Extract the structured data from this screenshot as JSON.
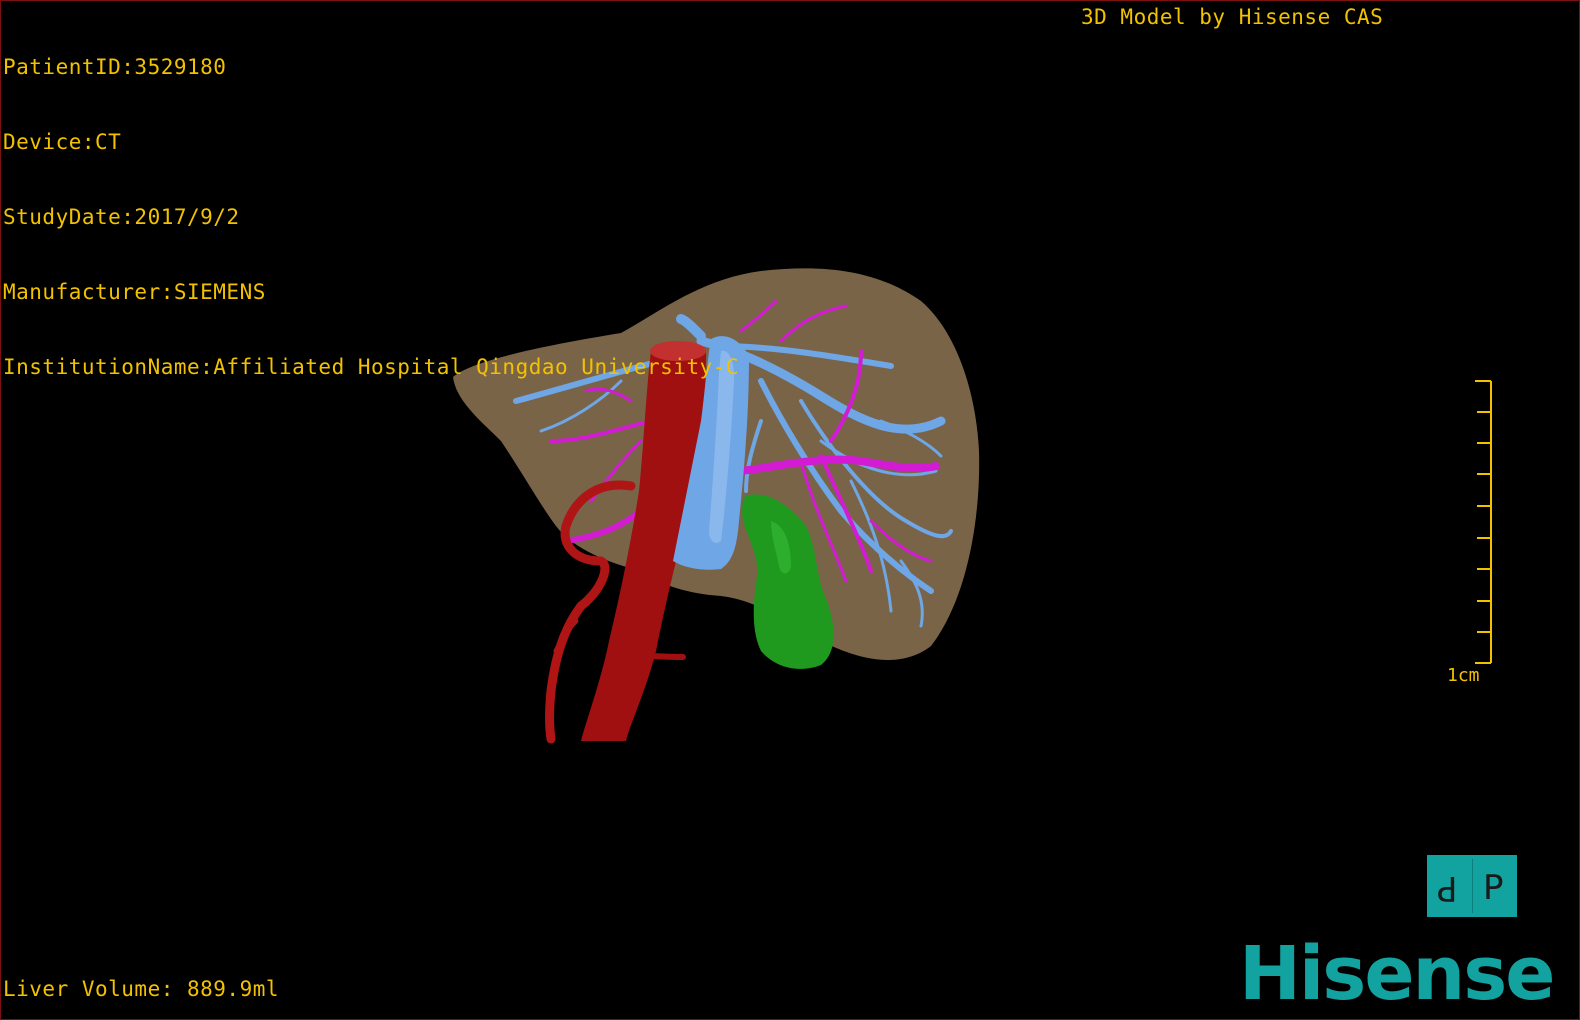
{
  "study_info": {
    "patient_id": "PatientID:3529180",
    "device": "Device:CT",
    "study_date": "StudyDate:2017/9/2",
    "manufacturer": "Manufacturer:SIEMENS",
    "institution": "InstitutionName:Affiliated Hospital Qingdao University-C"
  },
  "credit": "3D Model by Hisense CAS",
  "liver_volume": "Liver Volume: 889.9ml",
  "scale_bar": {
    "label": "1cm",
    "ticks": 10
  },
  "orientation_cube": {
    "left_face": "P",
    "right_face": "P",
    "color": "#12a3a0"
  },
  "brand": {
    "text": "Hisense",
    "color": "#12a3a0"
  },
  "colors": {
    "overlay_text": "#f2c200",
    "liver": "#7a6448",
    "artery": "#b01515",
    "vena_cava": "#6fa6e6",
    "hepatic_vein": "#6fa6e6",
    "portal_vein": "#d21bd2",
    "gallbladder": "#1f9a1f"
  },
  "model_parts": [
    "liver-surface",
    "aorta",
    "inferior-vena-cava",
    "hepatic-veins",
    "portal-veins",
    "gallbladder",
    "hepatic-artery"
  ]
}
